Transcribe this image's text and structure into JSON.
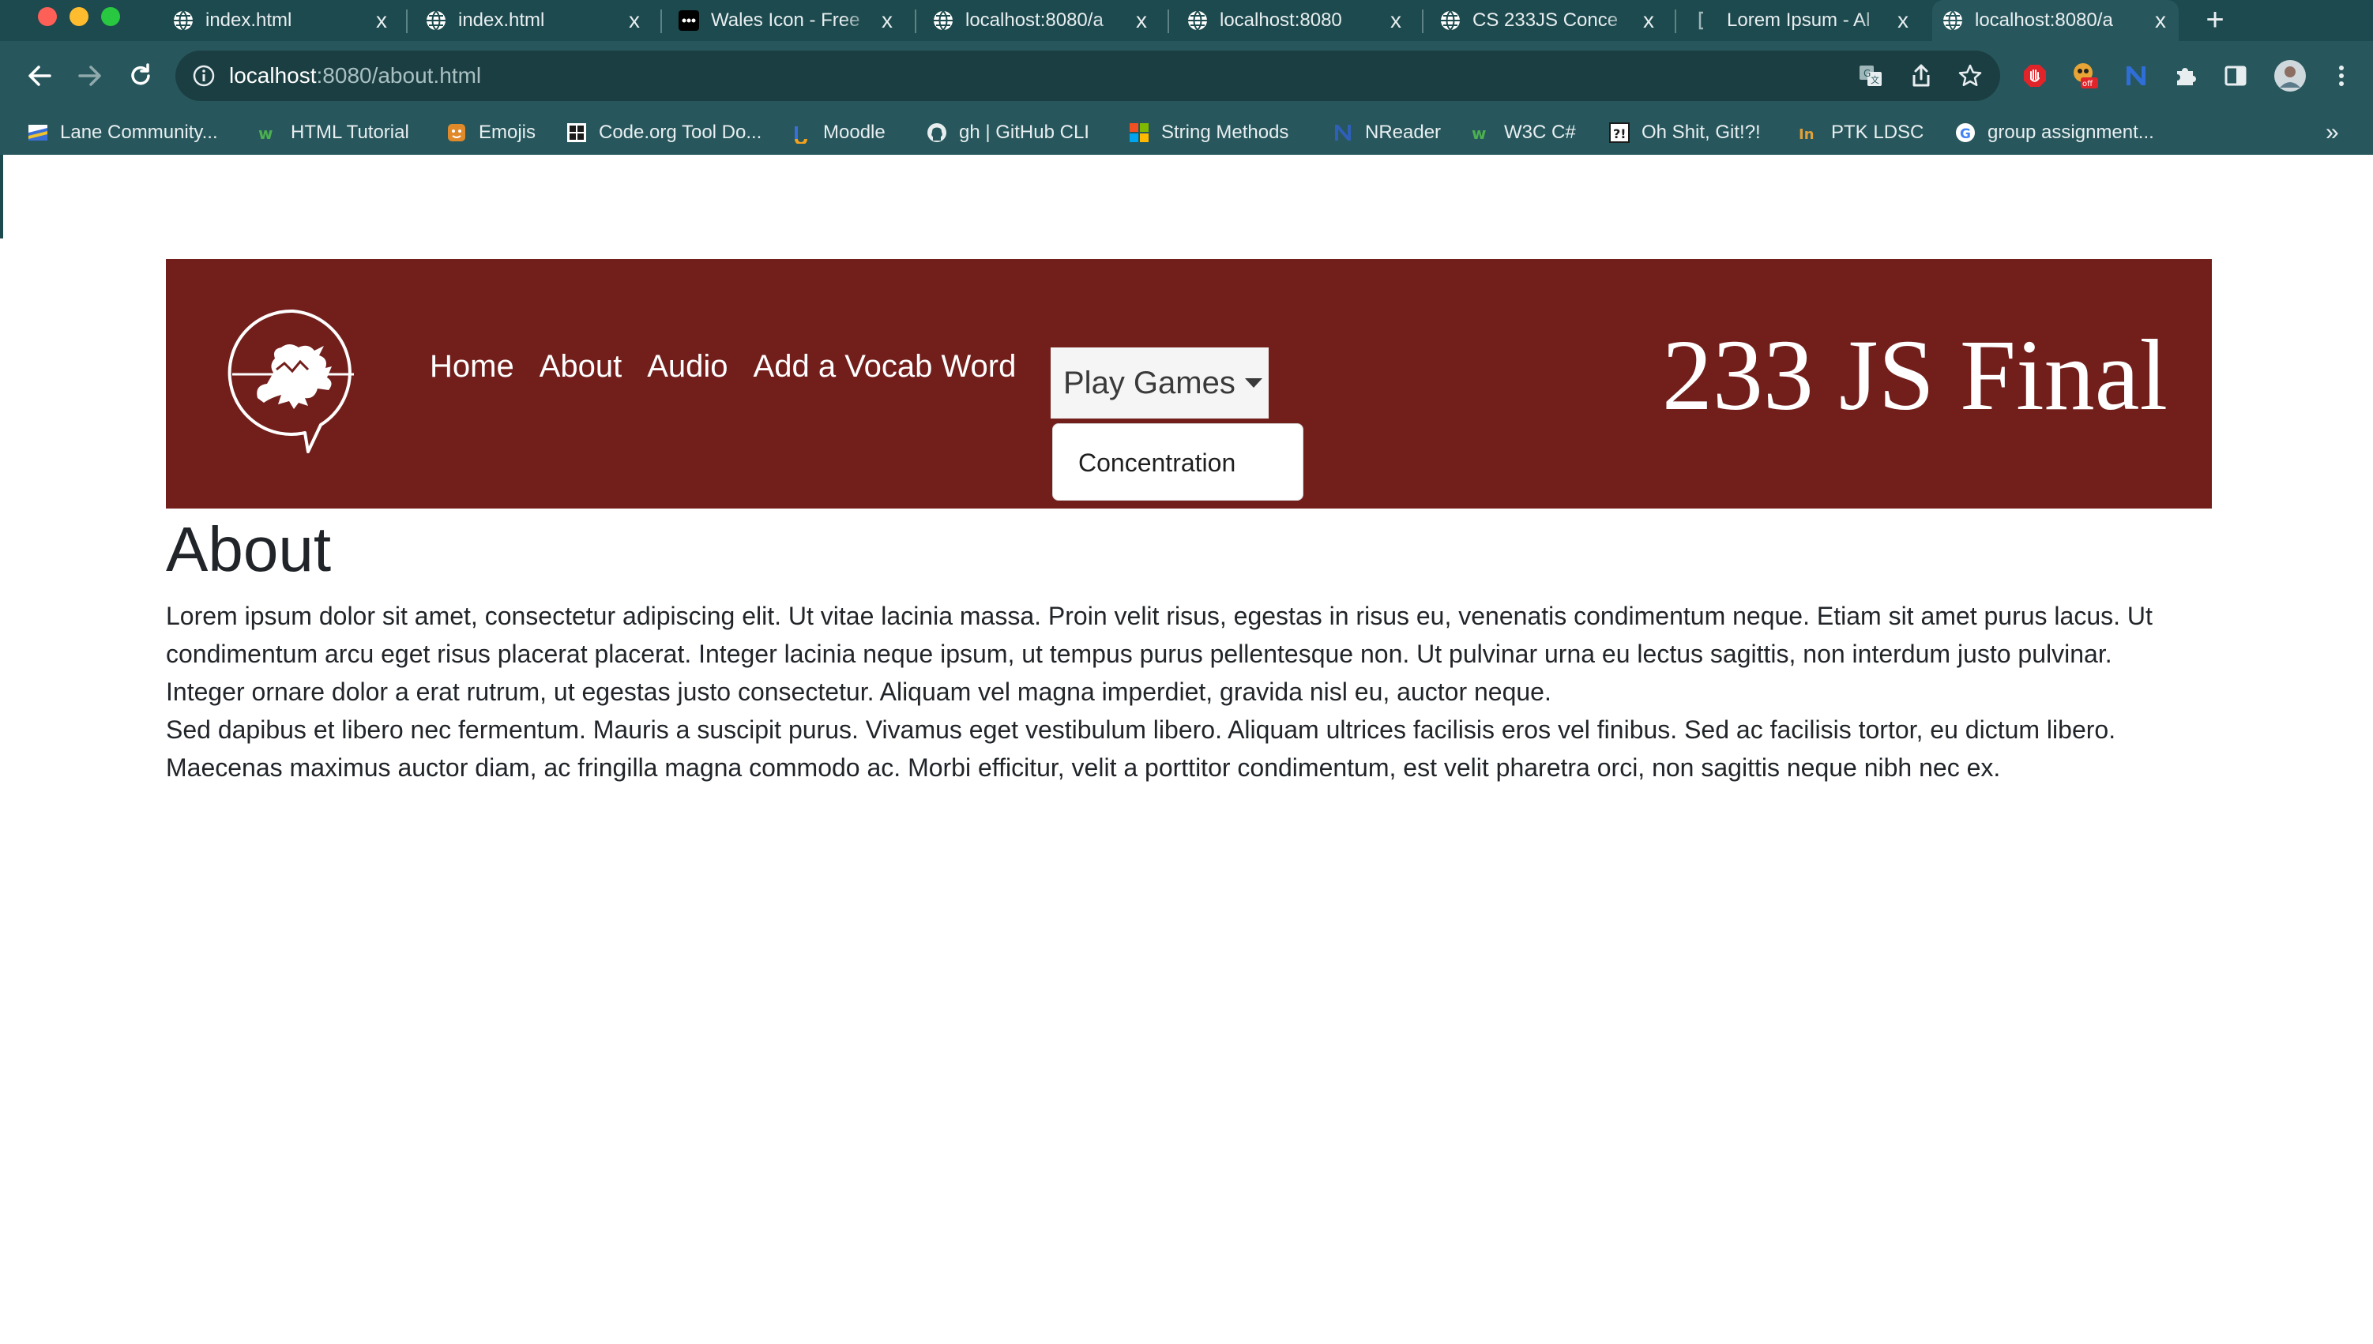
{
  "browser": {
    "tabs": [
      {
        "title": "index.html",
        "icon": "globe-icon"
      },
      {
        "title": "index.html",
        "icon": "globe-icon"
      },
      {
        "title": "Wales Icon - Free",
        "icon": "dots-icon"
      },
      {
        "title": "localhost:8080/a",
        "icon": "globe-icon"
      },
      {
        "title": "localhost:8080",
        "icon": "globe-icon"
      },
      {
        "title": "CS 233JS Conce",
        "icon": "globe-icon"
      },
      {
        "title": "Lorem Ipsum - Al",
        "icon": "bracket-icon"
      },
      {
        "title": "localhost:8080/a",
        "icon": "globe-icon",
        "active": true
      }
    ],
    "close_glyph": "x",
    "new_tab_glyph": "+",
    "url_host": "localhost",
    "url_rest": ":8080/about.html",
    "bookmarks": [
      {
        "label": "Lane Community...",
        "icon": "lane-icon"
      },
      {
        "label": "HTML Tutorial",
        "icon": "w3-icon"
      },
      {
        "label": "Emojis",
        "icon": "emoji-icon"
      },
      {
        "label": "Code.org Tool Do...",
        "icon": "codeorg-icon"
      },
      {
        "label": "Moodle",
        "icon": "moodle-icon"
      },
      {
        "label": "gh | GitHub CLI",
        "icon": "github-icon"
      },
      {
        "label": "String Methods",
        "icon": "microsoft-icon"
      },
      {
        "label": "NReader",
        "icon": "nreader-icon"
      },
      {
        "label": "W3C C#",
        "icon": "w3-icon"
      },
      {
        "label": "Oh Shit, Git!?!",
        "icon": "git-icon"
      },
      {
        "label": "PTK LDSC",
        "icon": "ptk-icon"
      },
      {
        "label": "group assignment...",
        "icon": "google-icon"
      }
    ],
    "bookmarks_more": "»",
    "colors": {
      "tab_bar": "#1d4a4e",
      "toolbar": "#27575c"
    }
  },
  "site": {
    "nav": [
      "Home",
      "About",
      "Audio",
      "Add a Vocab Word"
    ],
    "dropdown_label": "Play Games",
    "dropdown_items": [
      "Concentration"
    ],
    "title": "233 JS Final",
    "logo": "wales-dragon-logo",
    "header_color": "#721f1c"
  },
  "page": {
    "heading": "About",
    "paragraphs": [
      "Lorem ipsum dolor sit amet, consectetur adipiscing elit. Ut vitae lacinia massa. Proin velit risus, egestas in risus eu, venenatis condimentum neque. Etiam sit amet purus lacus. Ut",
      "condimentum arcu eget risus placerat placerat. Integer lacinia neque ipsum, ut tempus purus pellentesque non. Ut pulvinar urna eu lectus sagittis, non interdum justo pulvinar.",
      "Integer ornare dolor a erat rutrum, ut egestas justo consectetur. Aliquam vel magna imperdiet, gravida nisl eu, auctor neque.",
      "Sed dapibus et libero nec fermentum. Mauris a suscipit purus. Vivamus eget vestibulum libero. Aliquam ultrices facilisis eros vel finibus. Sed ac facilisis tortor, eu dictum libero.",
      "Maecenas maximus auctor diam, ac fringilla magna commodo ac. Morbi efficitur, velit a porttitor condimentum, est velit pharetra orci, non sagittis neque nibh nec ex."
    ]
  }
}
